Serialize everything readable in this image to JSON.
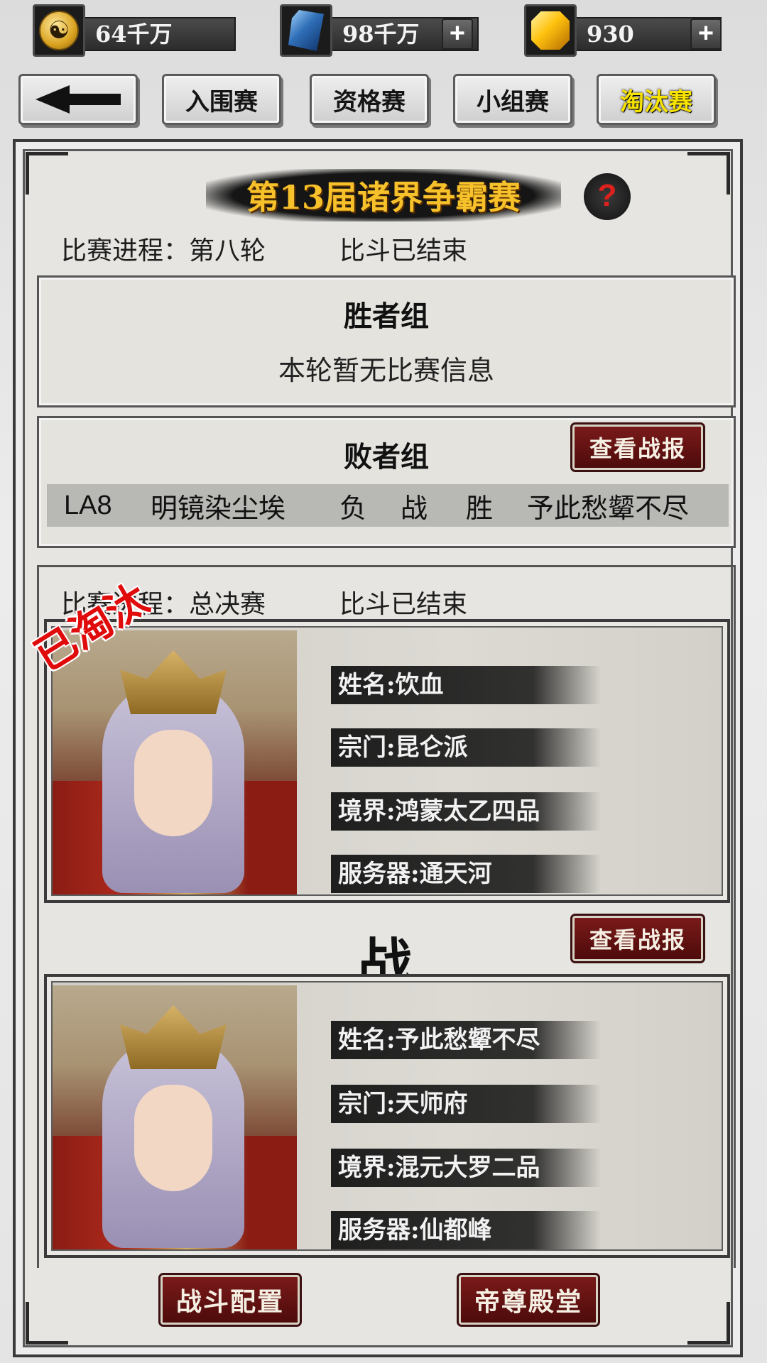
{
  "resources": {
    "coins": {
      "icon": "yin-yang-coin-icon",
      "value": "64千万"
    },
    "crystals": {
      "icon": "blue-crystal-icon",
      "value": "98千万"
    },
    "gold": {
      "icon": "gold-gem-icon",
      "value": "930"
    },
    "plus_label": "+"
  },
  "tabs": [
    {
      "label": "入围赛",
      "active": false
    },
    {
      "label": "资格赛",
      "active": false
    },
    {
      "label": "小组赛",
      "active": false
    },
    {
      "label": "淘汰赛",
      "active": true
    }
  ],
  "title": "第13届诸界争霸赛",
  "help_label": "?",
  "round_status": {
    "progress": "比赛进程：第八轮",
    "state": "比斗已结束"
  },
  "winners_group": {
    "title": "胜者组",
    "empty_text": "本轮暂无比赛信息"
  },
  "losers_group": {
    "title": "败者组",
    "report_button": "查看战报",
    "match": {
      "server": "LA8",
      "player_a": "明镜染尘埃",
      "result": [
        "负",
        "战",
        "胜"
      ],
      "player_b": "予此愁颦不尽"
    }
  },
  "final_status": {
    "progress": "比赛进程：总决赛",
    "state": "比斗已结束"
  },
  "fighter_top": {
    "eliminated_tag": "已淘汰",
    "name": "姓名:饮血",
    "sect": "宗门:昆仑派",
    "realm": "境界:鸿蒙太乙四品",
    "server": "服务器:通天河"
  },
  "vs_label": "战",
  "final_report_button": "查看战报",
  "fighter_bottom": {
    "name": "姓名:予此愁颦不尽",
    "sect": "宗门:天师府",
    "realm": "境界:混元大罗二品",
    "server": "服务器:仙都峰"
  },
  "bottom_buttons": {
    "battle_config": "战斗配置",
    "emperor_hall": "帝尊殿堂"
  }
}
